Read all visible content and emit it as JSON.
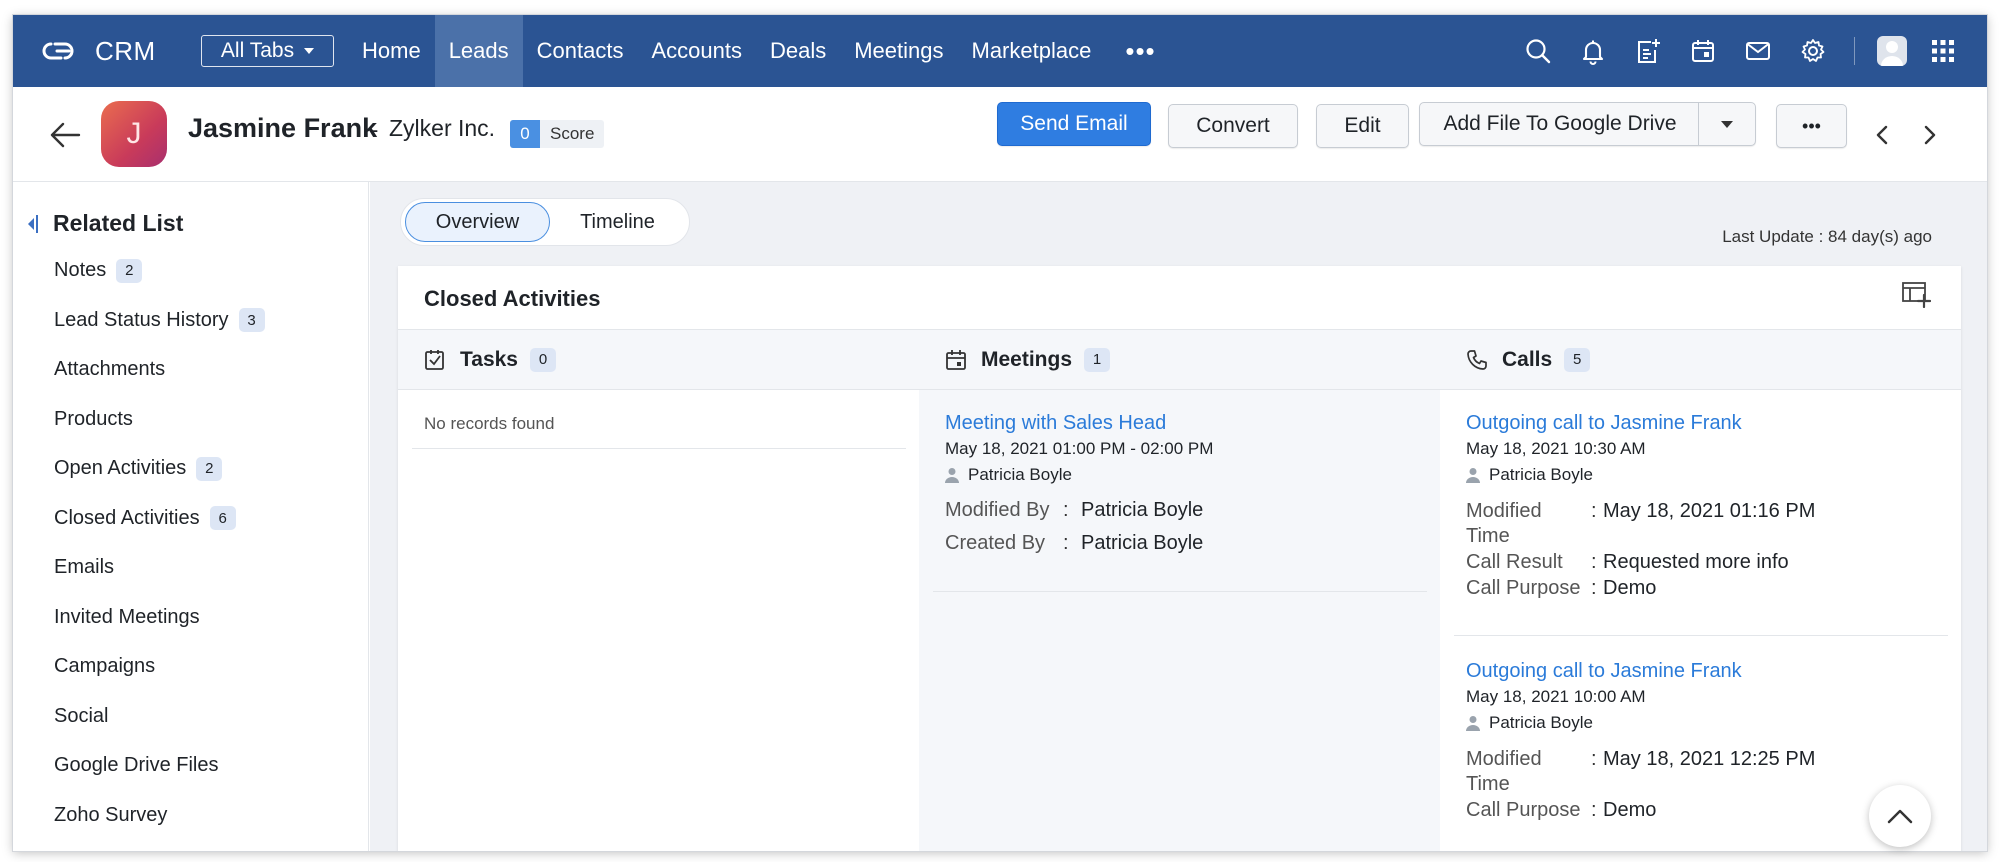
{
  "app": {
    "name": "CRM",
    "all_tabs_label": "All Tabs"
  },
  "nav": {
    "tabs": [
      {
        "label": "Home"
      },
      {
        "label": "Leads",
        "active": true
      },
      {
        "label": "Contacts"
      },
      {
        "label": "Accounts"
      },
      {
        "label": "Deals"
      },
      {
        "label": "Meetings"
      },
      {
        "label": "Marketplace"
      }
    ],
    "more_label": "•••",
    "icons": [
      "search-icon",
      "bell-icon",
      "add-note-icon",
      "calendar-icon",
      "mail-icon",
      "gear-icon",
      "profile-icon",
      "apps-grid-icon"
    ]
  },
  "record": {
    "avatar_letter": "J",
    "name": "Jasmine Frank",
    "separator": "-",
    "company": "Zylker Inc.",
    "score_value": "0",
    "score_label": "Score",
    "buttons": {
      "send_email": "Send Email",
      "convert": "Convert",
      "edit": "Edit",
      "add_file": "Add File To Google Drive",
      "more": "•••"
    }
  },
  "sidebar": {
    "title": "Related List",
    "items": [
      {
        "label": "Notes",
        "count": "2"
      },
      {
        "label": "Lead Status History",
        "count": "3"
      },
      {
        "label": "Attachments",
        "count": null
      },
      {
        "label": "Products",
        "count": null
      },
      {
        "label": "Open Activities",
        "count": "2"
      },
      {
        "label": "Closed Activities",
        "count": "6"
      },
      {
        "label": "Emails",
        "count": null
      },
      {
        "label": "Invited Meetings",
        "count": null
      },
      {
        "label": "Campaigns",
        "count": null
      },
      {
        "label": "Social",
        "count": null
      },
      {
        "label": "Google Drive Files",
        "count": null
      },
      {
        "label": "Zoho Survey",
        "count": null
      }
    ]
  },
  "view": {
    "tabs": [
      "Overview",
      "Timeline"
    ],
    "last_update": "Last Update : 84 day(s) ago"
  },
  "closed_activities": {
    "title": "Closed Activities",
    "tasks": {
      "title": "Tasks",
      "count": "0",
      "empty_text": "No records found"
    },
    "meetings": {
      "title": "Meetings",
      "count": "1",
      "items": [
        {
          "title": "Meeting with Sales Head",
          "date": "May 18, 2021 01:00 PM - 02:00 PM",
          "owner": "Patricia Boyle",
          "modified_by_label": "Modified By",
          "modified_by": "Patricia Boyle",
          "created_by_label": "Created By",
          "created_by": "Patricia Boyle"
        }
      ]
    },
    "calls": {
      "title": "Calls",
      "count": "5",
      "items": [
        {
          "title": "Outgoing call to Jasmine Frank",
          "date": "May 18, 2021 10:30 AM",
          "owner": "Patricia Boyle",
          "modified_time_label_1": "Modified",
          "modified_time_label_2": "Time",
          "modified_time": "May 18, 2021 01:16 PM",
          "result_label": "Call Result",
          "result": "Requested more info",
          "purpose_label": "Call Purpose",
          "purpose": "Demo"
        },
        {
          "title": "Outgoing call to Jasmine Frank",
          "date": "May 18, 2021 10:00 AM",
          "owner": "Patricia Boyle",
          "modified_time_label_1": "Modified",
          "modified_time_label_2": "Time",
          "modified_time": "May 18, 2021 12:25 PM",
          "purpose_label": "Call Purpose",
          "purpose": "Demo"
        }
      ]
    }
  },
  "colon": ":",
  "colors": {
    "nav_bg": "#2b5493",
    "nav_active": "#4b71a9",
    "primary": "#2f7de1",
    "link": "#2b7bd9",
    "badge_bg": "#dde6f5"
  }
}
